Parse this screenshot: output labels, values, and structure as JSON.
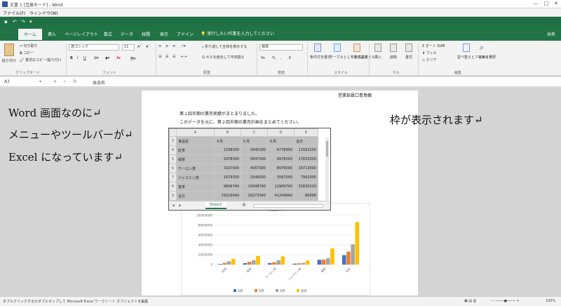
{
  "window": {
    "title": "文書 1 [互換モード] - Word",
    "controls": [
      "—",
      "□",
      "✕"
    ]
  },
  "menubar": {
    "items": [
      "ファイル(F)",
      "ウィンドウ(W)"
    ]
  },
  "ribbon_tabs": {
    "items": [
      "ホーム",
      "挿入",
      "ページレイアウト",
      "数式",
      "データ",
      "校閲",
      "表示",
      "アドイン"
    ],
    "active": "ホーム",
    "tell_me": "実行したい作業を入力してください",
    "signin": "共有"
  },
  "ribbon": {
    "clipboard": {
      "paste": "貼り付け",
      "cut": "切り取り",
      "copy": "コピー",
      "format_painter": "書式のコピー/貼り付け",
      "label": "クリップボード"
    },
    "font": {
      "name": "游ゴシック",
      "size": "11",
      "label": "フォント"
    },
    "alignment": {
      "wrap": "折り返して全体を表示する",
      "merge": "セルを結合して中央揃え",
      "label": "配置"
    },
    "number": {
      "format": "標準",
      "label": "数値"
    },
    "styles": {
      "conditional": "条件付き書式",
      "table": "テーブルとして書式設定",
      "cell": "セルのスタイル",
      "label": "スタイル"
    },
    "cells": {
      "insert": "挿入",
      "delete": "削除",
      "format": "書式",
      "label": "セル"
    },
    "editing": {
      "autosum": "オート SUM",
      "fill": "フィル",
      "clear": "クリア",
      "sort": "並べ替えとフィルター",
      "find": "検索と選択",
      "label": "編集"
    }
  },
  "formula_bar": {
    "cell_ref": "A3",
    "content": "食品名"
  },
  "document": {
    "heading": "営業部員口青島職",
    "line1": "第１四半期の業売実績がまとまりました。",
    "line2": "このデータを元に、第２四半期の業売計画をまとめてください。"
  },
  "annotations": {
    "left": [
      "Word 画面なのに↵",
      "メニューやツールバーが↵",
      "Excel になっています↵"
    ],
    "right": "枠が表示されます↵"
  },
  "sheet": {
    "col_headers": [
      "A",
      "B",
      "C",
      "D",
      "E"
    ],
    "rows": [
      {
        "num": "3",
        "cells": [
          "食品名",
          "４月",
          "５月",
          "６月",
          "合計"
        ]
      },
      {
        "num": "4",
        "cells": [
          "紅茶",
          "1338300",
          "3445300",
          "6778900",
          "11561500"
        ]
      },
      {
        "num": "5",
        "cells": [
          "緑茶",
          "2978300",
          "5647000",
          "8978000",
          "17603300"
        ]
      },
      {
        "num": "6",
        "cells": [
          "ウーロン茶",
          "3167000",
          "4567000",
          "8978000",
          "16713000"
        ]
      },
      {
        "num": "7",
        "cells": [
          "ジャスミン茶",
          "1879300",
          "2548000",
          "3567000",
          "7992000"
        ]
      },
      {
        "num": "8",
        "cells": [
          "麦茶",
          "9856740",
          "10098740",
          "12909740",
          "32830220"
        ]
      },
      {
        "num": "9",
        "cells": [
          "合計",
          "19219040",
          "26273040",
          "41204640",
          "86698"
        ]
      }
    ],
    "tab": "Sheet1"
  },
  "chart_data": {
    "type": "bar",
    "title": "売上高",
    "categories": [
      "紅茶",
      "緑茶",
      "ウーロン茶",
      "ジャスミン茶",
      "麦茶",
      "合計"
    ],
    "series": [
      {
        "name": "4月",
        "values": [
          1338300,
          2978300,
          3167000,
          1879300,
          9856740,
          19219040
        ]
      },
      {
        "name": "5月",
        "values": [
          3445300,
          5647000,
          4567000,
          2548000,
          10098740,
          26273040
        ]
      },
      {
        "name": "6月",
        "values": [
          6778900,
          8978000,
          8978000,
          3567000,
          12909740,
          41204640
        ]
      },
      {
        "name": "合計",
        "values": [
          11561500,
          17603300,
          16713000,
          7992000,
          32830220,
          86698000
        ]
      }
    ],
    "ylim": [
      0,
      100000000
    ],
    "yticks": [
      "100000000",
      "80000000",
      "60000000",
      "40000000",
      "20000000",
      "0"
    ],
    "colors": [
      "#4472c4",
      "#ed7d31",
      "#a5a5a5",
      "#ffc000"
    ],
    "legend": "bottom",
    "grid": true
  },
  "statusbar": {
    "left": "ダブルクリックするかダブルタップして Microsoft Excel ワークシート オブジェクトを編集",
    "zoom": "100%"
  },
  "colors": {
    "accent": "#217346"
  }
}
